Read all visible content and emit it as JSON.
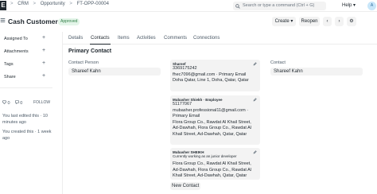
{
  "nav": {
    "logo": "E",
    "breadcrumbs": [
      "CRM",
      "Opportunity",
      "FT-OPP-00004"
    ],
    "separator": ">",
    "search_placeholder": "Search or type a command (Ctrl + G)",
    "help": "Help",
    "help_caret": "▾",
    "avatar": "A"
  },
  "header": {
    "title": "Cash Customers",
    "status": "Approved",
    "create": "Create",
    "create_caret": "▾",
    "reopen": "Reopen",
    "prev": "‹",
    "next": "›",
    "settings": "⚙"
  },
  "sidebar": {
    "items": [
      {
        "label": "Assigned To",
        "plus": "+"
      },
      {
        "label": "Attachments",
        "plus": "+"
      },
      {
        "label": "Tags",
        "plus": "+"
      },
      {
        "label": "Share",
        "plus": "+"
      }
    ],
    "likes": "0",
    "comments": "0",
    "follow": "FOLLOW",
    "activity": [
      "You last edited this · 10 minutes ago",
      "You created this · 1 week ago"
    ]
  },
  "tabs": [
    "Details",
    "Contacts",
    "Items",
    "Activities",
    "Comments",
    "Connections"
  ],
  "active_tab": "Contacts",
  "primary_contact": {
    "section_title": "Primary Contact",
    "contact_person_label": "Contact Person",
    "contact_person_value": "Shareef Kahn",
    "contact_label": "Contact",
    "contact_value": "Shareef Kahn"
  },
  "contacts": [
    {
      "name": "Shareef",
      "lines": [
        "3369175242",
        "fhec7096@gmail.com · Primary Email",
        "Doha Qatar, Line 1, Doha, Qatar, Qatar"
      ]
    },
    {
      "name": "Mubasher Shiekh · Employee",
      "lines": [
        "51177067",
        "mubasher.professional11@gmail.com · Primary Email",
        "Flora Group Co., Rawdat Al Khail Street, Ad-Dawhah, Flora Group Co., Rawdat Al Khail Street, Ad-Dawhah, Qatar, Qatar"
      ]
    },
    {
      "name": "Mubasher SHEIKH",
      "subtitle": "Currently working as an junior developer",
      "lines": [
        "Flora Group Co., Rawdat Al Khail Street, Ad-Dawhah, Flora Group Co., Rawdat Al Khail Street, Ad-Dawhah, Qatar, Qatar"
      ]
    }
  ],
  "new_contact": "New Contact",
  "icons": {
    "menu": "hamburger-icon",
    "search": "search-icon",
    "edit": "pencil-icon",
    "like": "heart-icon",
    "comment": "comment-icon"
  }
}
